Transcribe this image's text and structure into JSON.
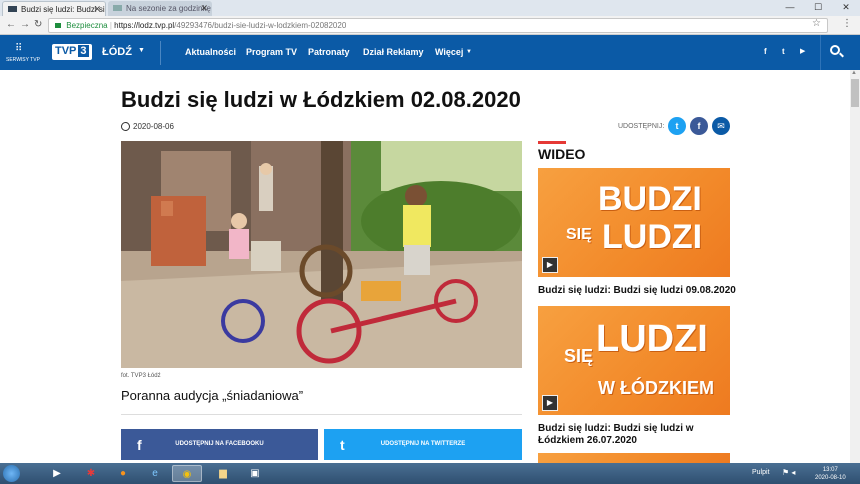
{
  "browser": {
    "tabs": [
      {
        "label": "Budzi się ludzi: Budzi się"
      },
      {
        "label": "Na sezonie za godzinkę O..."
      }
    ],
    "nav": {
      "back": "←",
      "forward": "→",
      "reload": "↻"
    },
    "address": {
      "secure_label": "Bezpieczna",
      "url_host": "https://lodz.tvp.pl",
      "url_path": "/49293476/budzi-sie-ludzi-w-lodzkiem-02082020"
    },
    "window_controls": {
      "minimize": "—",
      "maximize": "☐",
      "close": "✕"
    }
  },
  "site": {
    "serwisy_label": "SERWISY TVP",
    "logo_text": "TVP",
    "logo_number": "3",
    "region": "ŁÓDŹ",
    "nav": [
      {
        "label": "Aktualności"
      },
      {
        "label": "Program TV"
      },
      {
        "label": "Patronaty"
      },
      {
        "label": "Dział Reklamy"
      },
      {
        "label": "Więcej"
      }
    ],
    "social": {
      "facebook": "f",
      "twitter": "t",
      "youtube": "▶"
    },
    "brand_color": "#0b5aa6"
  },
  "article": {
    "title": "Budzi się ludzi w Łódzkiem 02.08.2020",
    "date": "2020-08-06",
    "share_label": "UDOSTĘPNIJ:",
    "caption": "fot. TVP3 Łódź",
    "lead": "Poranna audycja „śniadaniowa”",
    "share_facebook": "UDOSTĘPNIJ NA FACEBOOKU",
    "share_twitter": "UDOSTĘPNIJ NA TWITTERZE"
  },
  "sidebar": {
    "heading": "WIDEO",
    "videos": [
      {
        "thumb_line1": "BUDZI",
        "thumb_line2": "SIĘ",
        "thumb_line3": "LUDZI",
        "title": "Budzi się ludzi: Budzi się ludzi 09.08.2020"
      },
      {
        "thumb_line1": "SIĘ",
        "thumb_line2": "LUDZI",
        "thumb_line3": "W ŁÓDZKIEM",
        "title": "Budzi się ludzi: Budzi się ludzi w Łódzkiem 26.07.2020"
      }
    ]
  },
  "taskbar": {
    "pulpit": "Pulpit",
    "time": "13:07",
    "date": "2020-08-10"
  }
}
